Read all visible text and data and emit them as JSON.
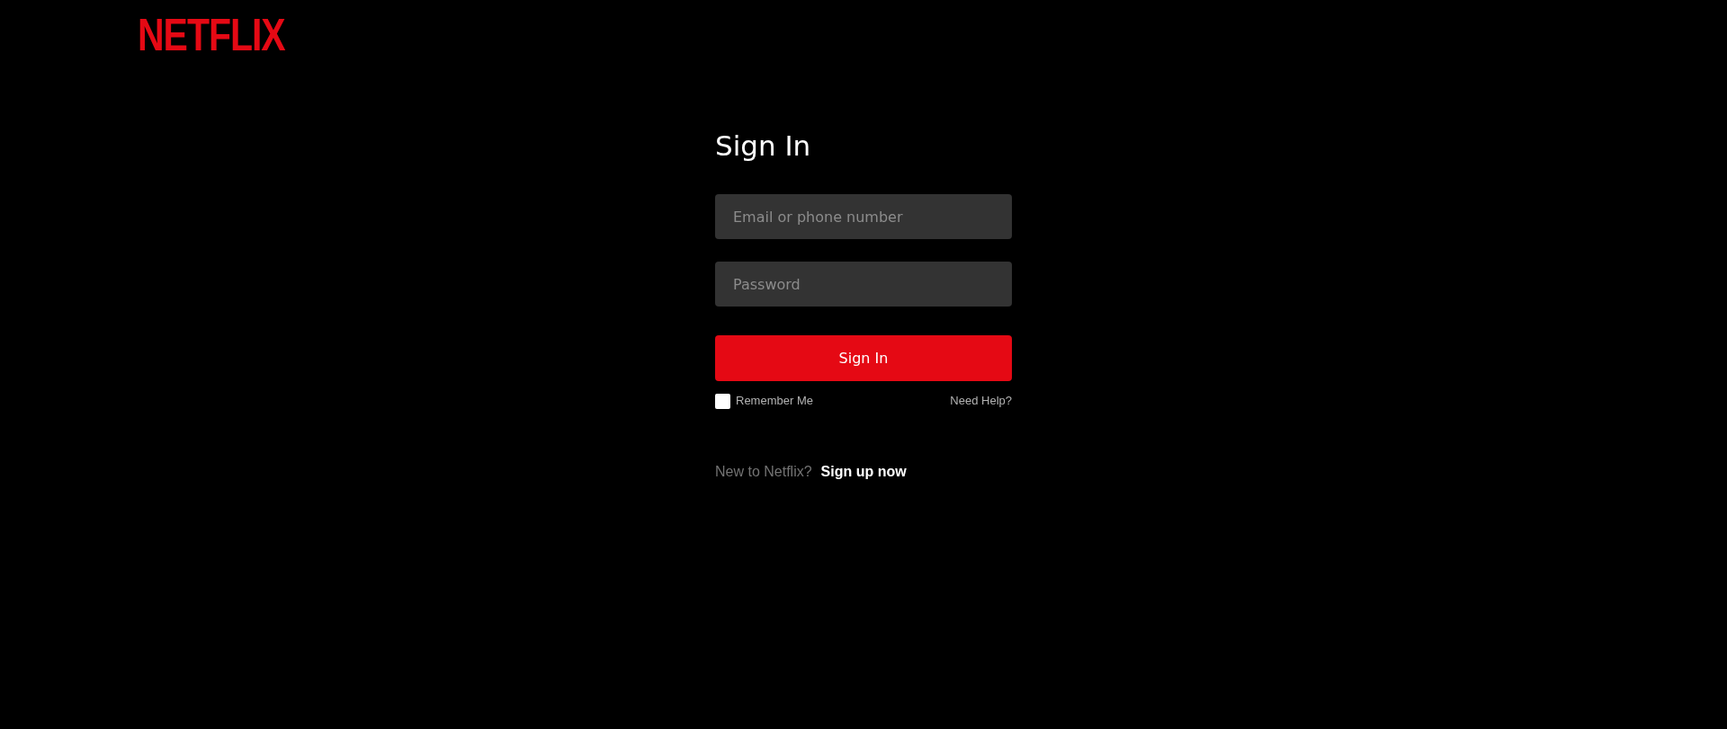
{
  "logo": {
    "text": "NETFLIX"
  },
  "form": {
    "title": "Sign In",
    "fields": [
      {
        "placeholder": "Email or phone number"
      },
      {
        "placeholder": "Password"
      }
    ],
    "submit": "Sign In",
    "remember": {
      "label": "Remember Me",
      "checked": false
    },
    "help": "Need Help?",
    "signup_prompt": "New to Netflix?",
    "signup_link": "Sign up now"
  }
}
